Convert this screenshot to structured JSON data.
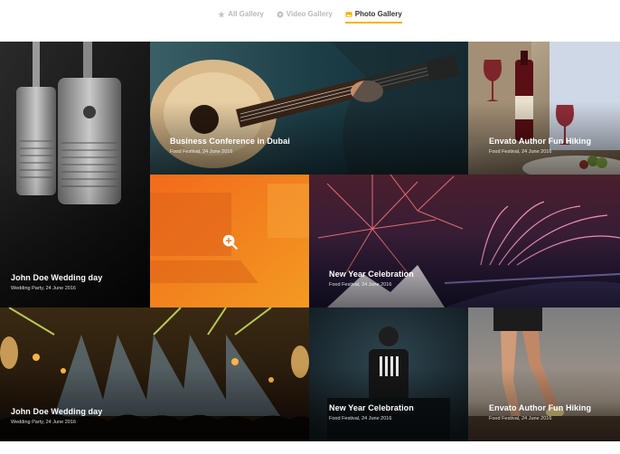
{
  "tabs": [
    {
      "label": "All Gallery",
      "icon": "star-icon",
      "active": false
    },
    {
      "label": "Video Gallery",
      "icon": "play-circle-icon",
      "active": false
    },
    {
      "label": "Photo Gallery",
      "icon": "image-icon",
      "active": true
    }
  ],
  "tiles": [
    {
      "title": "John Doe Wedding day",
      "subtitle": "Wedding Party, 24 June 2016",
      "image": "microphones-photo"
    },
    {
      "title": "Business Conference in Dubai",
      "subtitle": "Food Festival, 24 June 2016",
      "image": "guitar-photo"
    },
    {
      "title": "Envato Author Fun Hiking",
      "subtitle": "Food Festival, 24 June 2016",
      "image": "wine-dinner-photo"
    },
    {
      "title": "",
      "subtitle": "",
      "image": "laptop-photo",
      "hover_icon": "zoom-in-icon"
    },
    {
      "title": "New Year Celebration",
      "subtitle": "Food Festival, 24 June 2016",
      "image": "fireworks-photo"
    },
    {
      "title": "John Doe Wedding day",
      "subtitle": "Wedding Party, 24 June 2016",
      "image": "concert-photo"
    },
    {
      "title": "New Year Celebration",
      "subtitle": "Food Festival, 24 June 2016",
      "image": "dj-photo"
    },
    {
      "title": "Envato Author Fun Hiking",
      "subtitle": "Food Festival, 24 June 2016",
      "image": "runner-photo"
    }
  ],
  "colors": {
    "accent": "#f5b400",
    "overlay_orange": "#f07b1e"
  }
}
